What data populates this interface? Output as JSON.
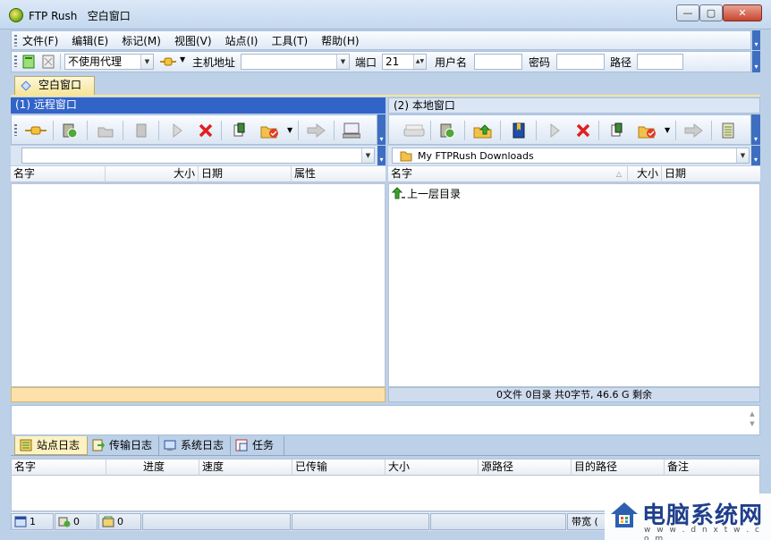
{
  "window": {
    "title": "FTP Rush   空白窗口",
    "min": "▭",
    "max": "▢",
    "close": "✕"
  },
  "menu": [
    {
      "label": "文件(F)"
    },
    {
      "label": "编辑(E)"
    },
    {
      "label": "标记(M)"
    },
    {
      "label": "视图(V)"
    },
    {
      "label": "站点(I)"
    },
    {
      "label": "工具(T)"
    },
    {
      "label": "帮助(H)"
    }
  ],
  "connect": {
    "proxy": "不使用代理",
    "host_label": "主机地址",
    "host_value": "",
    "port_label": "端口",
    "port_value": "21",
    "user_label": "用户名",
    "user_value": "",
    "password_label": "密码",
    "password_value": "",
    "path_label": "路径",
    "path_value": ""
  },
  "doc_tab": {
    "label": "空白窗口"
  },
  "remote": {
    "title": "(1) 远程窗口",
    "path": "",
    "columns": [
      "名字",
      "大小",
      "日期",
      "属性"
    ],
    "status": ""
  },
  "local": {
    "title": "(2) 本地窗口",
    "path": "My FTPRush Downloads",
    "columns": [
      "名字",
      "大小",
      "日期"
    ],
    "rows": [
      {
        "name": "上一层目录"
      }
    ],
    "status": "0文件 0目录 共0字节, 46.6 G 剩余"
  },
  "log_tabs": [
    {
      "label": "站点日志",
      "icon": "site-log-icon"
    },
    {
      "label": "传输日志",
      "icon": "transfer-log-icon"
    },
    {
      "label": "系统日志",
      "icon": "system-log-icon"
    },
    {
      "label": "任务",
      "icon": "task-icon"
    }
  ],
  "task_columns": [
    "名字",
    "进度",
    "速度",
    "已传输",
    "大小",
    "源路径",
    "目的路径",
    "备注"
  ],
  "statusbar": {
    "windows": "1",
    "sites": "0",
    "queue": "0",
    "bandwidth": "带宽 ("
  },
  "watermark": {
    "text": "电脑系统网",
    "sub": "w w w . d n x t w . c o m"
  }
}
